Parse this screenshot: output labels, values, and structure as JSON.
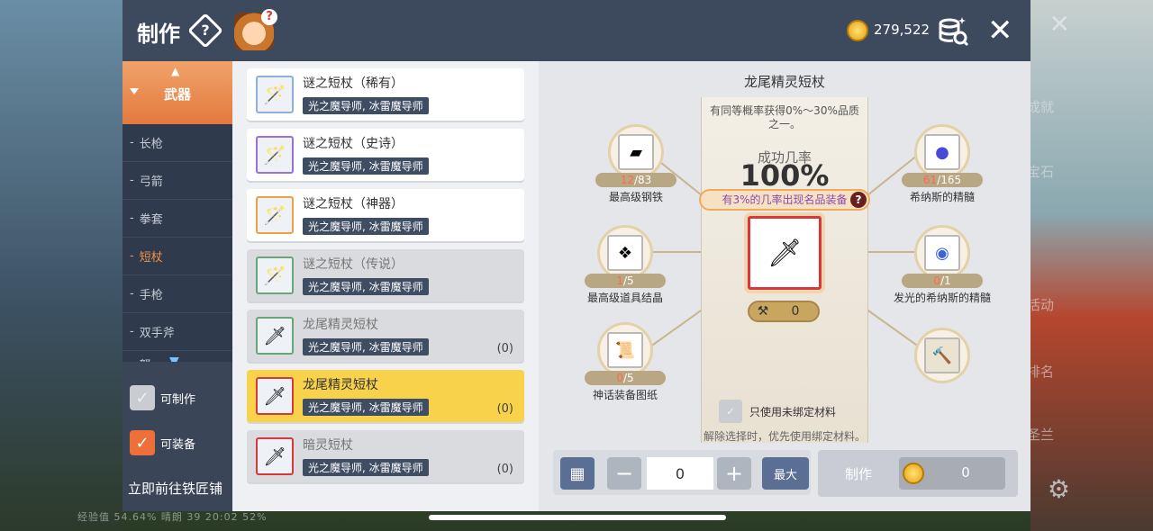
{
  "window": {
    "title": "制作",
    "meso": "279,522"
  },
  "categories": {
    "selected_group": "武器",
    "items": [
      {
        "label": "长枪",
        "active": false
      },
      {
        "label": "弓箭",
        "active": false
      },
      {
        "label": "拳套",
        "active": false
      },
      {
        "label": "短杖",
        "active": true
      },
      {
        "label": "手枪",
        "active": false
      },
      {
        "label": "双手斧",
        "active": false
      },
      {
        "label": "弩",
        "active": false
      }
    ]
  },
  "filters": {
    "craftable": "可制作",
    "equippable": "可装备",
    "goto_smith": "立即前往铁匠铺"
  },
  "recipes": [
    {
      "name": "谜之短杖（稀有）",
      "tag": "光之魔导师, 冰雷魔导师",
      "count": "",
      "state": "normal"
    },
    {
      "name": "谜之短杖（史诗）",
      "tag": "光之魔导师, 冰雷魔导师",
      "count": "",
      "state": "normal"
    },
    {
      "name": "谜之短杖（神器）",
      "tag": "光之魔导师, 冰雷魔导师",
      "count": "",
      "state": "normal"
    },
    {
      "name": "谜之短杖（传说）",
      "tag": "光之魔导师, 冰雷魔导师",
      "count": "",
      "state": "locked"
    },
    {
      "name": "龙尾精灵短杖",
      "tag": "光之魔导师, 冰雷魔导师",
      "count": "(0)",
      "state": "locked"
    },
    {
      "name": "龙尾精灵短杖",
      "tag": "光之魔导师, 冰雷魔导师",
      "count": "(0)",
      "state": "selected"
    },
    {
      "name": "暗灵短杖",
      "tag": "光之魔导师, 冰雷魔导师",
      "count": "(0)",
      "state": "locked"
    }
  ],
  "detail": {
    "item_name": "龙尾精灵短杖",
    "prob_note": "有同等概率获得0%～30%品质之一。",
    "success_label": "成功几率",
    "success_value": "100%",
    "famous_note": "有3%的几率出现名品装备",
    "hammer_count": "0",
    "only_unbound": "只使用未绑定材料",
    "unbound_note": "解除选择时，优先使用绑定材料。",
    "materials": [
      {
        "name": "最高级钢铁",
        "have": "12",
        "need": "/83"
      },
      {
        "name": "最高级道具结晶",
        "have": "1",
        "need": "/5"
      },
      {
        "name": "神话装备图纸",
        "have": "0",
        "need": "/5"
      },
      {
        "name": "希纳斯的精髓",
        "have": "61",
        "need": "/165"
      },
      {
        "name": "发光的希纳斯的精髓",
        "have": "0",
        "need": "/1"
      }
    ]
  },
  "quantity": {
    "value": "0",
    "max_label": "最大"
  },
  "craft": {
    "label": "制作",
    "cost": "0"
  },
  "status_bar": {
    "text": "经验值 54.64%   晴朗 39   20:02   52%"
  },
  "side_hints": {
    "r1": "成就",
    "r2": "宝石",
    "r3": "活动",
    "r4": "排名",
    "r5": "圣兰"
  }
}
